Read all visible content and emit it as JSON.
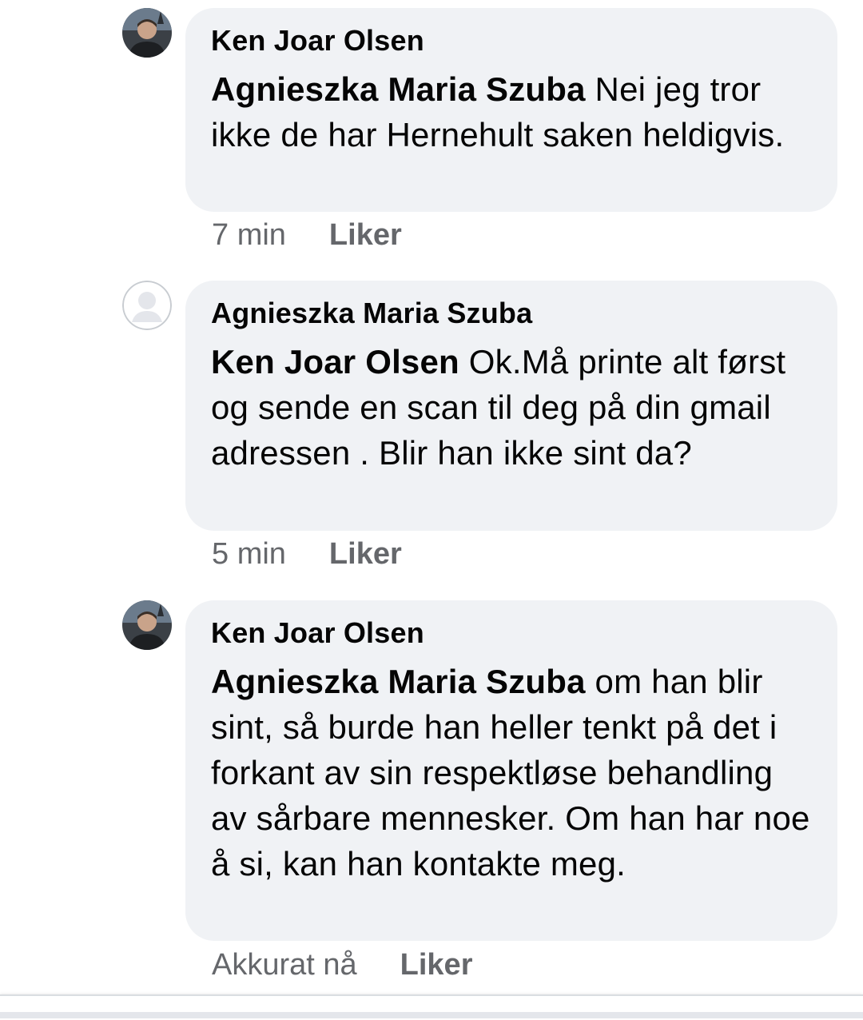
{
  "comments": [
    {
      "author": "Ken Joar Olsen",
      "mention": "Agnieszka Maria Szuba",
      "text": " Nei jeg tror ikke de har Hernehult saken heldigvis.",
      "time": "7 min",
      "like_label": "Liker",
      "avatar_icon": "profile-photo-icon"
    },
    {
      "author": "Agnieszka Maria Szuba",
      "mention": "Ken Joar Olsen",
      "text": " Ok.Må printe alt først og sende en scan til deg på din gmail adressen . Blir han ikke sint da?",
      "time": "5 min",
      "like_label": "Liker",
      "avatar_icon": "default-avatar-icon"
    },
    {
      "author": "Ken Joar Olsen",
      "mention": "Agnieszka Maria Szuba",
      "text": " om han blir sint, så burde han heller tenkt på det i forkant av sin respektløse behandling av sårbare mennesker. Om han har noe å si, kan han kontakte meg.",
      "time": "Akkurat nå",
      "like_label": "Liker",
      "avatar_icon": "profile-photo-icon"
    }
  ],
  "colors": {
    "bubble": "#f0f2f5",
    "meta_text": "#65676b",
    "text": "#050505"
  }
}
